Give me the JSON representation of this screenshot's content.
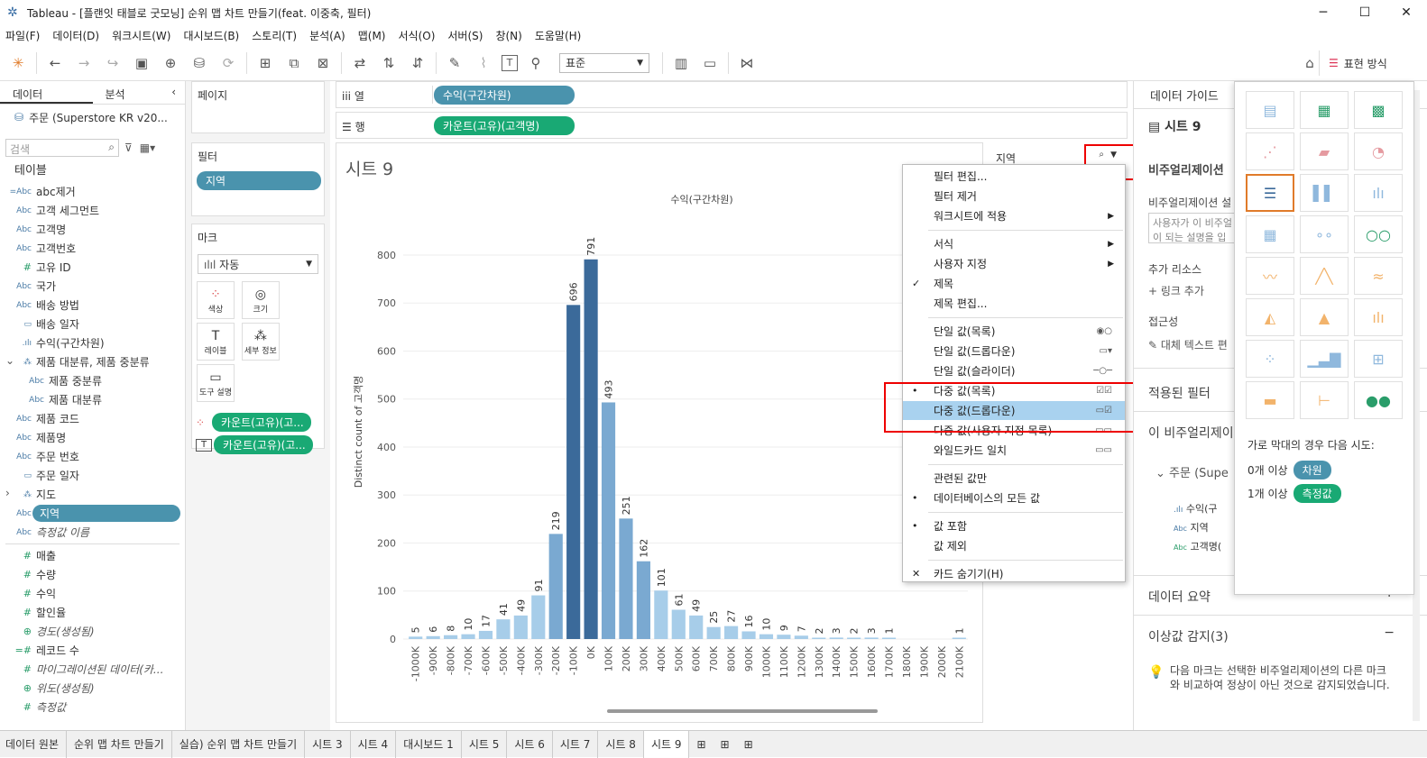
{
  "window": {
    "title": "Tableau - [플랜잇 태블로 굿모닝] 순위 맵 차트 만들기(feat. 이중축, 필터)"
  },
  "menu": [
    "파일(F)",
    "데이터(D)",
    "워크시트(W)",
    "대시보드(B)",
    "스토리(T)",
    "분석(A)",
    "맵(M)",
    "서식(O)",
    "서버(S)",
    "창(N)",
    "도움말(H)"
  ],
  "toolbar": {
    "fit_select": "표준",
    "showme_label": "표현 방식"
  },
  "left": {
    "tab_data": "데이터",
    "tab_analysis": "분석",
    "datasource": "주문 (Superstore KR v20...",
    "search_placeholder": "검색",
    "tables_header": "테이블",
    "fields": [
      {
        "icon": "=Abc",
        "label": "abc제거",
        "it": false
      },
      {
        "icon": "Abc",
        "label": "고객 세그먼트",
        "it": false
      },
      {
        "icon": "Abc",
        "label": "고객명",
        "it": false
      },
      {
        "icon": "Abc",
        "label": "고객번호",
        "it": false
      },
      {
        "icon": "#",
        "label": "고유 ID",
        "it": false
      },
      {
        "icon": "Abc",
        "label": "국가",
        "it": false
      },
      {
        "icon": "Abc",
        "label": "배송 방법",
        "it": false
      },
      {
        "icon": "cal",
        "label": "배송 일자",
        "it": false
      },
      {
        "icon": "bin",
        "label": "수익(구간차원)",
        "it": false
      },
      {
        "icon": "hier",
        "label": "제품 대분류, 제품 중분류",
        "it": false
      },
      {
        "icon": "Abc",
        "label": "제품 중분류",
        "it": false
      },
      {
        "icon": "Abc",
        "label": "제품 대분류",
        "it": false
      },
      {
        "icon": "Abc",
        "label": "제품 코드",
        "it": false
      },
      {
        "icon": "Abc",
        "label": "제품명",
        "it": false
      },
      {
        "icon": "Abc",
        "label": "주문 번호",
        "it": false
      },
      {
        "icon": "cal",
        "label": "주문 일자",
        "it": false
      },
      {
        "icon": "hier",
        "label": "지도",
        "it": false
      },
      {
        "icon": "Abc",
        "label": "지역",
        "it": false
      },
      {
        "icon": "Abc",
        "label": "측정값 이름",
        "it": true
      },
      {
        "icon": "#",
        "label": "매출",
        "it": false
      },
      {
        "icon": "#",
        "label": "수량",
        "it": false
      },
      {
        "icon": "#",
        "label": "수익",
        "it": false
      },
      {
        "icon": "#",
        "label": "할인율",
        "it": false
      },
      {
        "icon": "globe",
        "label": "경도(생성됨)",
        "it": true
      },
      {
        "icon": "=#",
        "label": "레코드 수",
        "it": false
      },
      {
        "icon": "#",
        "label": "마이그레이션된 데이터(카...",
        "it": true
      },
      {
        "icon": "globe",
        "label": "위도(생성됨)",
        "it": true
      },
      {
        "icon": "#",
        "label": "측정값",
        "it": true
      }
    ]
  },
  "shelves": {
    "pages": "페이지",
    "filters": "필터",
    "filter_pill": "지역",
    "marks": "마크",
    "mark_type": "자동",
    "mark_buttons": [
      "색상",
      "크기",
      "레이블",
      "세부 정보",
      "도구 설명"
    ],
    "mark_pills": [
      "카운트(고유)(고...",
      "카운트(고유)(고..."
    ],
    "columns_label": "열",
    "rows_label": "행",
    "columns_pill": "수익(구간차원)",
    "rows_pill": "카운트(고유)(고객명)"
  },
  "sheet": {
    "title": "시트 9",
    "filter_card_title": "지역"
  },
  "chart_data": {
    "type": "bar",
    "title": "수익(구간차원)",
    "ylabel": "Distinct count of 고객명",
    "categories": [
      "-1000K",
      "-900K",
      "-800K",
      "-700K",
      "-600K",
      "-500K",
      "-400K",
      "-300K",
      "-200K",
      "-100K",
      "0K",
      "100K",
      "200K",
      "300K",
      "400K",
      "500K",
      "600K",
      "700K",
      "800K",
      "900K",
      "1000K",
      "1100K",
      "1200K",
      "1300K",
      "1400K",
      "1500K",
      "1600K",
      "1700K",
      "1800K",
      "1900K",
      "2000K",
      "2100K"
    ],
    "values": [
      5,
      6,
      8,
      10,
      17,
      41,
      49,
      91,
      219,
      696,
      791,
      493,
      251,
      162,
      101,
      61,
      49,
      25,
      27,
      16,
      10,
      9,
      7,
      2,
      3,
      2,
      3,
      1,
      null,
      null,
      null,
      1
    ],
    "value_labels": [
      "5",
      "6",
      "8",
      "10",
      "17",
      "41",
      "49",
      "91",
      "219",
      "696",
      "791",
      "493",
      "251",
      "162",
      "101",
      "61",
      "49",
      "25",
      "27",
      "16",
      "10",
      "9",
      "7",
      "2",
      "3",
      "2",
      "3",
      "1",
      "",
      "",
      "",
      "1"
    ],
    "ylim": [
      0,
      830
    ],
    "yticks": [
      "0",
      "100",
      "200",
      "300",
      "400",
      "500",
      "600",
      "700",
      "800"
    ],
    "colors": {
      "light": "#a7cde9",
      "mid": "#7aa9d1",
      "dark": "#3b6a9a"
    }
  },
  "dropdown": {
    "items": [
      {
        "label": "필터 편집...",
        "mark": "",
        "arrow": false,
        "glyph": ""
      },
      {
        "label": "필터 제거",
        "mark": "",
        "arrow": false,
        "glyph": ""
      },
      {
        "label": "워크시트에 적용",
        "mark": "",
        "arrow": true,
        "glyph": ""
      },
      {
        "sep": true
      },
      {
        "label": "서식",
        "mark": "",
        "arrow": true,
        "glyph": ""
      },
      {
        "label": "사용자 지정",
        "mark": "",
        "arrow": true,
        "glyph": ""
      },
      {
        "label": "제목",
        "mark": "✓",
        "arrow": false,
        "glyph": ""
      },
      {
        "label": "제목 편집...",
        "mark": "",
        "arrow": false,
        "glyph": ""
      },
      {
        "sep": true
      },
      {
        "label": "단일 값(목록)",
        "mark": "",
        "arrow": false,
        "glyph": "◉○"
      },
      {
        "label": "단일 값(드롭다운)",
        "mark": "",
        "arrow": false,
        "glyph": "▭▾"
      },
      {
        "label": "단일 값(슬라이더)",
        "mark": "",
        "arrow": false,
        "glyph": "─○─"
      },
      {
        "label": "다중 값(목록)",
        "mark": "•",
        "arrow": false,
        "glyph": "☑☑"
      },
      {
        "label": "다중 값(드롭다운)",
        "mark": "",
        "arrow": false,
        "glyph": "▭☑",
        "hl": true
      },
      {
        "label": "다중 값(사용자 지정 목록)",
        "mark": "",
        "arrow": false,
        "glyph": "▭▭"
      },
      {
        "label": "와일드카드 일치",
        "mark": "",
        "arrow": false,
        "glyph": "▭▭"
      },
      {
        "sep": true
      },
      {
        "label": "관련된 값만",
        "mark": "",
        "arrow": false,
        "glyph": ""
      },
      {
        "label": "데이터베이스의 모든 값",
        "mark": "•",
        "arrow": false,
        "glyph": ""
      },
      {
        "sep": true
      },
      {
        "label": "값 포함",
        "mark": "•",
        "arrow": false,
        "glyph": ""
      },
      {
        "label": "값 제외",
        "mark": "",
        "arrow": false,
        "glyph": ""
      },
      {
        "sep": true
      },
      {
        "label": "카드 숨기기(H)",
        "mark": "✕",
        "arrow": false,
        "glyph": ""
      }
    ]
  },
  "guide": {
    "header": "데이터 가이드",
    "sheet": "시트 9",
    "viz_header": "비주얼리제이션",
    "viz_desc_label": "비주얼리제이션 설",
    "viz_desc_ph": "사용자가 이 비주얼\n이 되는 설명을 입",
    "extra_resources": "추가 리소스",
    "add_link": "링크 추가",
    "access": "접근성",
    "alt_text": "대체 텍스트 편",
    "applied_filters": "적용된 필터",
    "this_viz": "이 비주얼리제이",
    "source": "주문 (Supe",
    "fields": [
      "수익(구",
      "지역",
      "고객명("
    ],
    "summary": "데이터 요약",
    "outliers": "이상값 감지(3)",
    "outlier_text": "다음 마크는 선택한 비주얼리제이션의 다른 마크와 비교하여 정상이 아닌 것으로 감지되었습니다."
  },
  "showme": {
    "hint": "가로 막대의 경우 다음 시도:",
    "dim_line": "0개 이상",
    "dim_pill": "차원",
    "meas_line": "1개 이상",
    "meas_pill": "측정값"
  },
  "tabs": [
    "데이터 원본",
    "순위 맵 차트 만들기",
    "실습) 순위 맵 차트 만들기",
    "시트 3",
    "시트 4",
    "대시보드 1",
    "시트 5",
    "시트 6",
    "시트 7",
    "시트 8",
    "시트 9"
  ]
}
